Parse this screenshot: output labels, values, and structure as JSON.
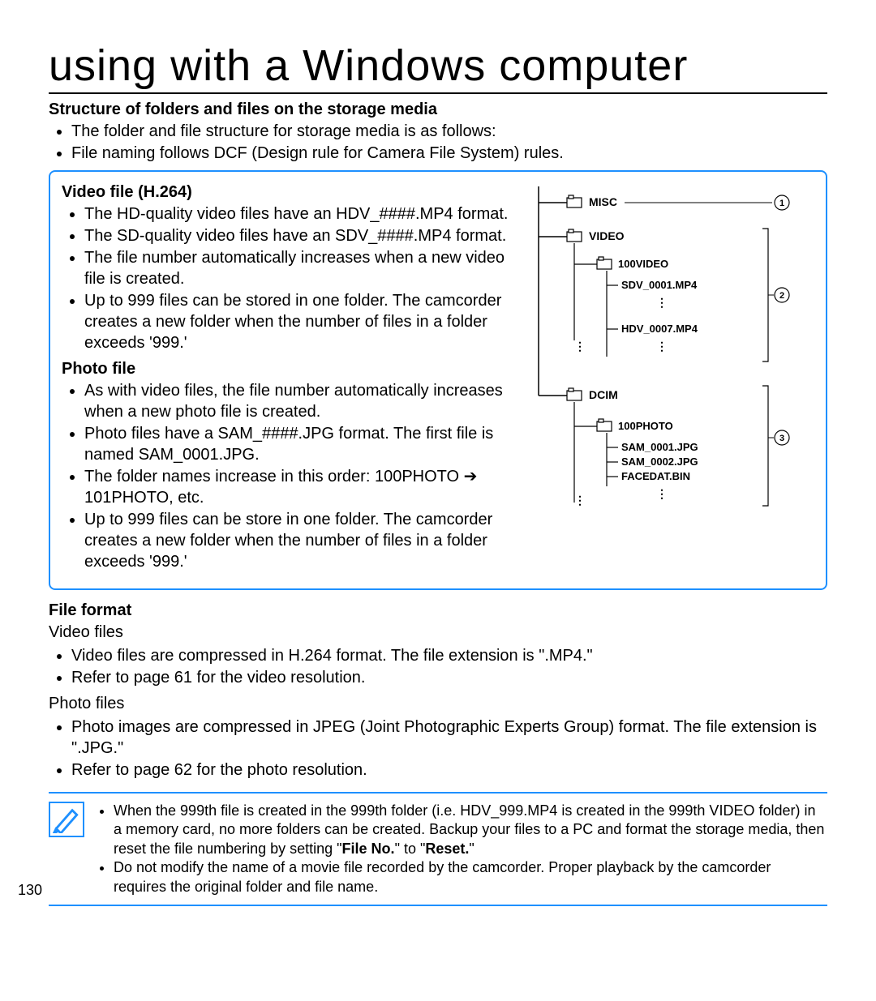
{
  "title": "using with a Windows computer",
  "structure": {
    "heading": "Structure of folders and files on the storage media",
    "bullets": [
      "The folder and file structure for storage media is as follows:",
      "File naming follows DCF (Design rule for Camera File System) rules."
    ]
  },
  "box": {
    "video": {
      "heading": "Video file (H.264)",
      "bullets": [
        "The HD-quality video files have an HDV_####.MP4 format.",
        "The SD-quality video files have an SDV_####.MP4 format.",
        "The file number automatically increases when a new video file is created.",
        "Up to 999 files can be stored in one folder. The camcorder creates a new folder when the number of files in a folder exceeds '999.'"
      ]
    },
    "photo": {
      "heading": "Photo file",
      "bullets": [
        "As with video files, the file number automatically increases when a new photo file is created.",
        "Photo files have a SAM_####.JPG format. The first file is named SAM_0001.JPG.",
        "The folder names increase in this order: 100PHOTO ➔ 101PHOTO, etc.",
        "Up to 999 files can be store in one folder. The camcorder creates a new folder when the number of files in a folder exceeds '999.'"
      ]
    }
  },
  "diagram": {
    "nodes": {
      "misc": "MISC",
      "video": "VIDEO",
      "folder_video": "100VIDEO",
      "file_sdv": "SDV_0001.MP4",
      "file_hdv": "HDV_0007.MP4",
      "dcim": "DCIM",
      "folder_photo": "100PHOTO",
      "file_sam1": "SAM_0001.JPG",
      "file_sam2": "SAM_0002.JPG",
      "file_facedat": "FACEDAT.BIN"
    },
    "markers": {
      "m1": "1",
      "m2": "2",
      "m3": "3"
    }
  },
  "file_format": {
    "heading": "File format",
    "video_sub": "Video files",
    "video_bullets": [
      "Video files are compressed in H.264 format. The file extension is \".MP4.\"",
      "Refer to page 61 for the video resolution."
    ],
    "photo_sub": "Photo files",
    "photo_bullets": [
      "Photo images are compressed in JPEG (Joint Photographic Experts Group) format. The file extension is \".JPG.\"",
      "Refer to page 62 for the photo resolution."
    ]
  },
  "note": {
    "bullets_html": [
      "When the 999th file is created in the 999th folder (i.e. HDV_999.MP4 is created in the 999th VIDEO folder) in a memory card, no more folders can be created. Backup your files to a PC and format the storage media, then reset the file numbering by setting \"<b>File No.</b>\" to \"<b>Reset.</b>\"",
      "Do not modify the name of a movie file recorded by the camcorder. Proper playback by the camcorder requires the original folder and file name."
    ]
  },
  "page_number": "130"
}
